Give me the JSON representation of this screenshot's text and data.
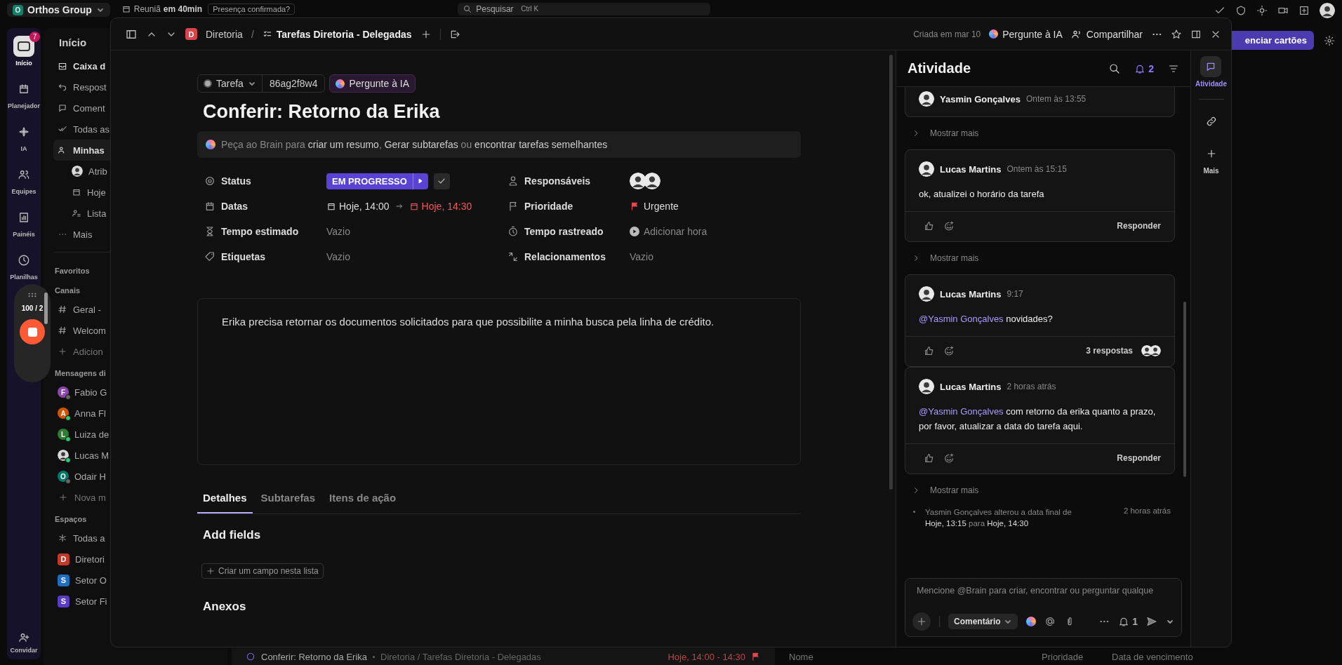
{
  "topbar": {
    "workspace": {
      "initial": "O",
      "name": "Orthos Group"
    },
    "meeting": {
      "title": "Reuniã",
      "time": "em 40min",
      "prompt": "Presença confirmada?"
    },
    "search": {
      "placeholder": "Pesquisar",
      "shortcut": "Ctrl K"
    }
  },
  "rail": {
    "items": [
      {
        "label": "Início",
        "badge": "7",
        "selected": true
      },
      {
        "label": "Planejador",
        "selected": false
      },
      {
        "label": "IA",
        "selected": false
      },
      {
        "label": "Equipes",
        "selected": false
      },
      {
        "label": "Painéis",
        "selected": false
      },
      {
        "label": "Planilhas",
        "selected": false
      }
    ],
    "invite": "Convidar"
  },
  "recorder": {
    "counter": "100 / 2"
  },
  "sidebar": {
    "title": "Início",
    "items": [
      {
        "label": "Caixa d",
        "unread": true,
        "selected": false
      },
      {
        "label": "Respost",
        "unread": false,
        "selected": false
      },
      {
        "label": "Coment",
        "unread": false,
        "selected": false
      },
      {
        "label": "Todas as",
        "unread": false,
        "selected": false
      },
      {
        "label": "Minhas",
        "unread": true,
        "selected": true,
        "children": [
          {
            "label": "Atrib",
            "kind": "photo"
          },
          {
            "label": "Hoje",
            "kind": "calendar"
          },
          {
            "label": "Lista",
            "kind": "list"
          }
        ]
      },
      {
        "label": "Mais",
        "unread": false,
        "selected": false
      }
    ],
    "favorites": "Favoritos",
    "channels": {
      "title": "Canais",
      "items": [
        {
          "kind": "channel",
          "label": "Geral -"
        },
        {
          "kind": "channel",
          "label": "Welcom"
        },
        {
          "kind": "add",
          "label": "Adicion"
        }
      ]
    },
    "messages": {
      "title": "Mensagens di",
      "items": [
        {
          "kind": "person",
          "initial": "F",
          "label": "Fabio G",
          "color": "#8e44ad",
          "online": false
        },
        {
          "kind": "person",
          "initial": "A",
          "label": "Anna Fl",
          "color": "#d35400",
          "online": true
        },
        {
          "kind": "person",
          "initial": "L",
          "label": "Luiza de",
          "color": "#2e7d32",
          "online": true
        },
        {
          "kind": "photo",
          "label": "Lucas M",
          "online": true
        },
        {
          "kind": "person",
          "initial": "O",
          "label": "Odair H",
          "color": "#00796b",
          "online": false
        },
        {
          "kind": "add",
          "label": "Nova m"
        }
      ]
    },
    "spaces": {
      "title": "Espaços",
      "items": [
        {
          "kind": "all",
          "label": "Todas a"
        },
        {
          "kind": "space",
          "initial": "D",
          "label": "Diretori",
          "color": "#c0392b"
        },
        {
          "kind": "space",
          "initial": "S",
          "label": "Setor O",
          "color": "#1e6fc0"
        },
        {
          "kind": "space",
          "initial": "S",
          "label": "Setor Fi",
          "color": "#5b3cc4"
        }
      ]
    }
  },
  "background": {
    "button": "enciar cartões",
    "list_row": {
      "title": "Conferir: Retorno da Erika",
      "path": "Diretoria / Tarefas Diretoria - Delegadas",
      "dates": "Hoje, 14:00 - 14:30"
    },
    "columns": [
      "Nome",
      "Prioridade",
      "Data de vencimento"
    ]
  },
  "task": {
    "header": {
      "space_initial": "D",
      "space": "Diretoria",
      "separator": "/",
      "list": "Tarefas Diretoria - Delegadas",
      "created": "Criada em mar 10",
      "ask_ai": "Pergunte à IA",
      "share": "Compartilhar"
    },
    "type": "Tarefa",
    "id": "86ag2f8w4",
    "ask_ai": "Pergunte à IA",
    "title": "Conferir: Retorno da Erika",
    "brain": [
      {
        "text": "Peça ao Brain para ",
        "action": false
      },
      {
        "text": "criar um resumo",
        "action": true
      },
      {
        "text": ", ",
        "action": false
      },
      {
        "text": "Gerar subtarefas",
        "action": true
      },
      {
        "text": " ou ",
        "action": false
      },
      {
        "text": "encontrar tarefas semelhantes",
        "action": true
      }
    ],
    "fields": [
      {
        "kind": "status",
        "label": "Status",
        "value": "EM PROGRESSO"
      },
      {
        "kind": "assignees",
        "label": "Responsáveis",
        "people": [
          {
            "kind": "photo"
          },
          {
            "kind": "photo"
          }
        ]
      },
      {
        "kind": "dates",
        "label": "Datas",
        "start": "Hoje, 14:00",
        "end": "Hoje, 14:30",
        "overdue": true
      },
      {
        "kind": "priority",
        "label": "Prioridade",
        "value": "Urgente",
        "color": "#e5484d"
      },
      {
        "kind": "estimate",
        "label": "Tempo estimado",
        "value": "Vazio"
      },
      {
        "kind": "tracked",
        "label": "Tempo rastreado",
        "value": "Adicionar hora"
      },
      {
        "kind": "tags",
        "label": "Etiquetas",
        "value": "Vazio"
      },
      {
        "kind": "relations",
        "label": "Relacionamentos",
        "value": "Vazio"
      }
    ],
    "description": "Erika precisa retornar os documentos solicitados para que possibilite a minha busca pela linha de crédito.",
    "tabs": [
      {
        "label": "Detalhes",
        "selected": true
      },
      {
        "label": "Subtarefas",
        "selected": false
      },
      {
        "label": "Itens de ação",
        "selected": false
      }
    ],
    "add_fields": "Add fields",
    "create_field": "Criar um campo nesta lista",
    "attachments": "Anexos"
  },
  "activity": {
    "title": "Atividade",
    "notifications": "2",
    "items": [
      {
        "kind": "comment",
        "clipped": true,
        "author": "Yasmin Gonçalves",
        "time": "Ontem às 13:55"
      },
      {
        "kind": "more",
        "label": "Mostrar mais"
      },
      {
        "kind": "comment",
        "clipped": false,
        "author": "Lucas Martins",
        "time": "Ontem às 15:15",
        "body": [
          {
            "text": "ok, atualizei o horário da tarefa",
            "mention": false
          }
        ],
        "reply": "Responder"
      },
      {
        "kind": "more",
        "label": "Mostrar mais"
      },
      {
        "kind": "comment",
        "clipped": false,
        "author": "Lucas Martins",
        "time": "9:17",
        "body": [
          {
            "text": "@Yasmin Gonçalves",
            "mention": true
          },
          {
            "text": " novidades?",
            "mention": false
          }
        ],
        "replies": "3 respostas"
      },
      {
        "kind": "comment",
        "clipped": false,
        "author": "Lucas Martins",
        "time": "2 horas atrás",
        "body": [
          {
            "text": "@Yasmin Gonçalves",
            "mention": true
          },
          {
            "text": " com retorno da erika quanto a prazo, por favor, atualizar a data do tarefa aqui.",
            "mention": false
          }
        ],
        "reply": "Responder"
      },
      {
        "kind": "more",
        "label": "Mostrar mais"
      },
      {
        "kind": "change",
        "text": "Yasmin Gonçalves alterou a data final de ",
        "from": "Hoje, 13:15",
        "joiner": " para ",
        "to": "Hoje, 14:30",
        "time": "2 horas atrás"
      }
    ],
    "composer": {
      "placeholder": "Mencione @Brain para criar, encontrar ou perguntar qualque",
      "mode": "Comentário",
      "notify": "1"
    }
  },
  "side": [
    {
      "kind": "activity",
      "label": "Atividade",
      "selected": true
    },
    {
      "kind": "links",
      "selected": false
    },
    {
      "kind": "more",
      "label": "Mais",
      "selected": false
    }
  ]
}
